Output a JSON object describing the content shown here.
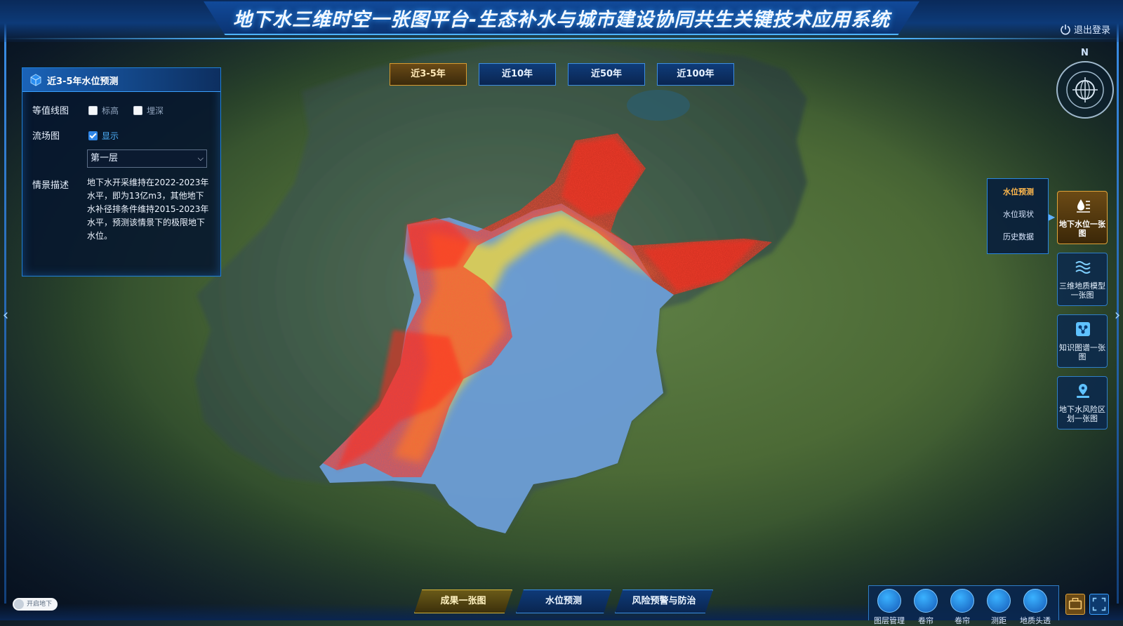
{
  "header": {
    "title": "地下水三维时空一张图平台-生态补水与城市建设协同共生关键技术应用系统",
    "logout_label": "退出登录"
  },
  "compass": {
    "north_label": "N"
  },
  "year_tabs": [
    {
      "label": "近3-5年",
      "active": true
    },
    {
      "label": "近10年",
      "active": false
    },
    {
      "label": "近50年",
      "active": false
    },
    {
      "label": "近100年",
      "active": false
    }
  ],
  "panel": {
    "title": "近3-5年水位预测",
    "contour_label": "等值线图",
    "contour_options": [
      {
        "label": "标高",
        "checked": false
      },
      {
        "label": "埋深",
        "checked": false
      }
    ],
    "flow_label": "流场图",
    "flow_option": {
      "label": "显示",
      "checked": true
    },
    "layer_select": "第一层",
    "scenario_label": "情景描述",
    "scenario_text": "地下水开采维持在2022-2023年水平，即为13亿m3，其他地下水补径排条件维持2015-2023年水平，预测该情景下的极限地下水位。"
  },
  "submenu": {
    "items": [
      {
        "label": "水位预测",
        "active": true
      },
      {
        "label": "水位现状",
        "active": false
      },
      {
        "label": "历史数据",
        "active": false
      }
    ]
  },
  "side_buttons": [
    {
      "label": "地下水位一张图",
      "icon": "water-level-icon",
      "active": true
    },
    {
      "label": "三维地质模型一张图",
      "icon": "geology-model-icon",
      "active": false
    },
    {
      "label": "知识图谱一张图",
      "icon": "knowledge-graph-icon",
      "active": false
    },
    {
      "label": "地下水风险区划一张图",
      "icon": "risk-map-icon",
      "active": false
    }
  ],
  "bottom_tabs": [
    {
      "label": "成果一张图",
      "active": true
    },
    {
      "label": "水位预测",
      "active": false
    },
    {
      "label": "风险预警与防治",
      "active": false
    }
  ],
  "toolbar": [
    {
      "label": "图层管理",
      "icon": "layers-icon"
    },
    {
      "label": "卷帘",
      "icon": "swipe-icon"
    },
    {
      "label": "卷帘",
      "icon": "split-icon"
    },
    {
      "label": "测距",
      "icon": "measure-icon"
    },
    {
      "label": "地质头透",
      "icon": "drop-icon"
    }
  ],
  "underground_toggle": {
    "label": "开启地下"
  },
  "colors": {
    "accent_blue": "#3aa0ff",
    "active_gold": "#d89a2e",
    "heat_high": "#ff2a1a",
    "heat_low": "#6f9fd8"
  }
}
